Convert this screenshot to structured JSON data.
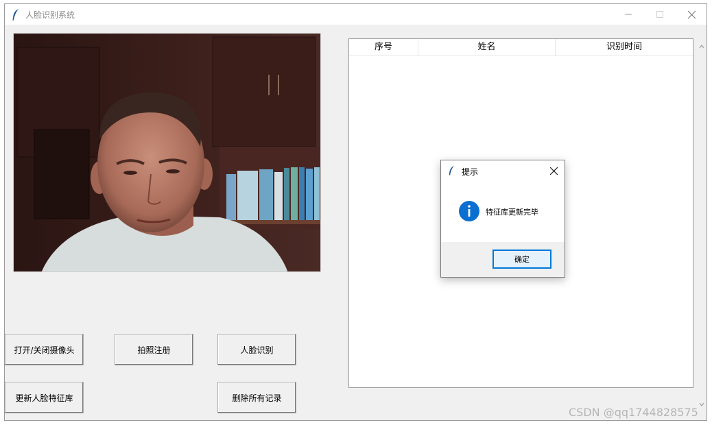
{
  "window": {
    "title": "人脸识别系统",
    "controls": {
      "minimize": "minimize-icon",
      "maximize": "maximize-icon",
      "close": "close-icon"
    }
  },
  "camera": {
    "icon": "webcam-feed-image"
  },
  "table": {
    "columns": [
      "序号",
      "姓名",
      "识别时间"
    ],
    "rows": []
  },
  "buttons": {
    "toggle_camera": "打开/关闭摄像头",
    "photo_register": "拍照注册",
    "face_recognize": "人脸识别",
    "update_features": "更新人脸特征库",
    "delete_records": "删除所有记录"
  },
  "dialog": {
    "title": "提示",
    "message": "特征库更新完毕",
    "ok_label": "确定",
    "icon": "info-icon"
  },
  "watermark": "CSDN @qq1744828575",
  "colors": {
    "accent": "#0078d7",
    "window_bg": "#f0f0f0"
  }
}
